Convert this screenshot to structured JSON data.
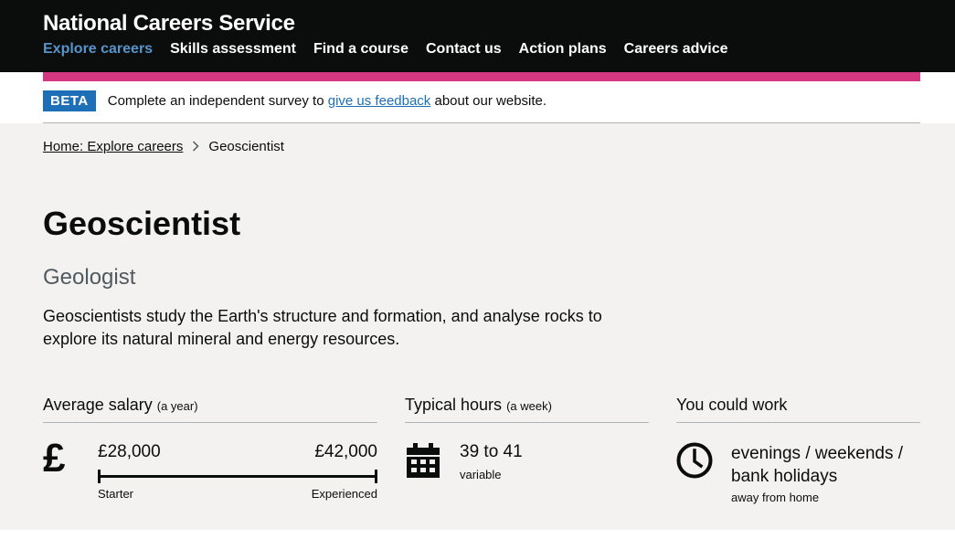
{
  "header": {
    "brand": "National Careers Service",
    "nav": [
      "Explore careers",
      "Skills assessment",
      "Find a course",
      "Contact us",
      "Action plans",
      "Careers advice"
    ]
  },
  "beta": {
    "tag": "BETA",
    "text_before": "Complete an independent survey to ",
    "link": "give us feedback",
    "text_after": " about our website."
  },
  "breadcrumb": {
    "home": "Home: Explore careers",
    "current": "Geoscientist"
  },
  "career": {
    "title": "Geoscientist",
    "alt_title": "Geologist",
    "summary": "Geoscientists study the Earth's structure and formation, and analyse rocks to explore its natural mineral and energy resources."
  },
  "salary": {
    "heading": "Average salary",
    "period": "(a year)",
    "symbol": "£",
    "starter_value": "£28,000",
    "experienced_value": "£42,000",
    "starter_label": "Starter",
    "experienced_label": "Experienced"
  },
  "hours": {
    "heading": "Typical hours",
    "period": "(a week)",
    "value": "39 to 41",
    "note": "variable"
  },
  "work": {
    "heading": "You could work",
    "value": "evenings / weekends / bank holidays",
    "note": "away from home"
  },
  "colors": {
    "header_bg": "#0b0c0c",
    "accent_bar": "#d53880",
    "beta_tag": "#1d70b8",
    "main_bg": "#f3f2f1"
  },
  "icons": {
    "salary": "pound-icon",
    "hours": "calendar-icon",
    "work": "clock-icon",
    "breadcrumb_separator": "chevron-right-icon"
  }
}
